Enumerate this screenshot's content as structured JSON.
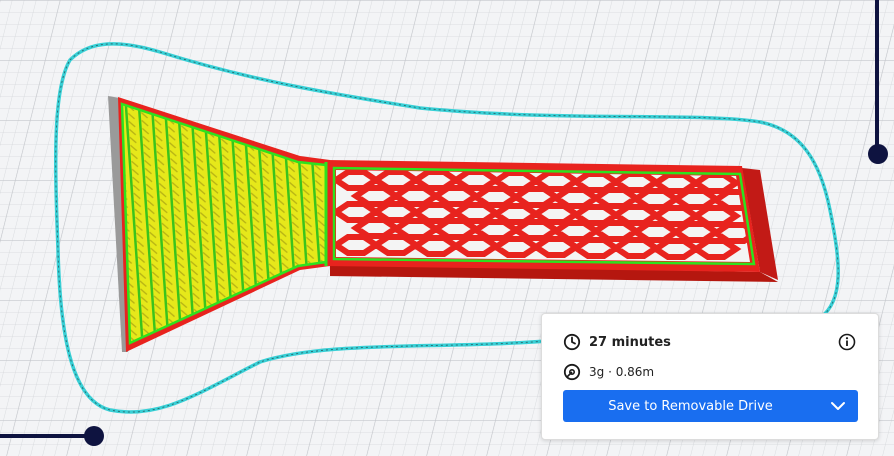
{
  "print_info": {
    "time_label": "27 minutes",
    "material_label": "3g · 0.86m"
  },
  "actions": {
    "save_label": "Save to Removable Drive"
  },
  "icons": {
    "time": "clock-icon",
    "material": "spool-icon",
    "info": "info-icon",
    "dropdown": "chevron-down-icon"
  },
  "colors": {
    "accent": "#196ef0",
    "handle": "#0e1340",
    "travel": "#38d0d6",
    "wall": "#e8231e",
    "infill_top": "#e6e81a",
    "inner_wall": "#2ee21e"
  }
}
